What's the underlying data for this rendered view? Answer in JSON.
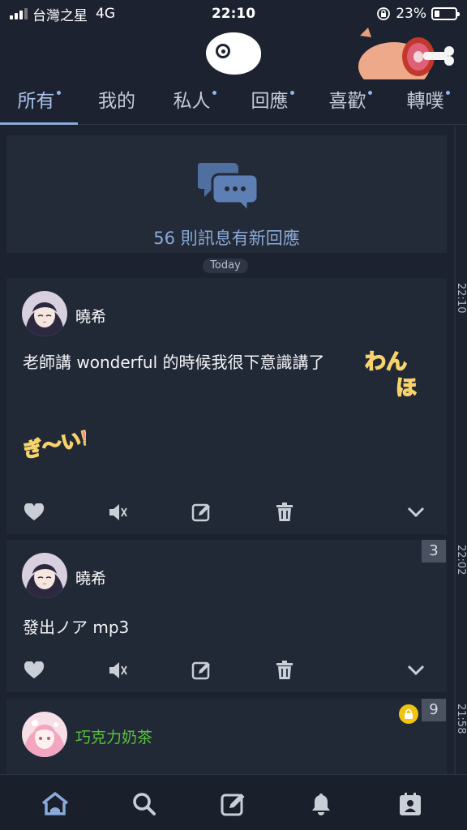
{
  "status_bar": {
    "carrier": "台灣之星",
    "network": "4G",
    "time": "22:10",
    "battery_percent_text": "23%",
    "battery_level": 0.23
  },
  "tabs": [
    {
      "label": "所有",
      "active": true,
      "dot": true
    },
    {
      "label": "我的",
      "active": false,
      "dot": false
    },
    {
      "label": "私人",
      "active": false,
      "dot": true
    },
    {
      "label": "回應",
      "active": false,
      "dot": true
    },
    {
      "label": "喜歡",
      "active": false,
      "dot": true
    },
    {
      "label": "轉噗",
      "active": false,
      "dot": true
    }
  ],
  "new_responses": {
    "text": "56 則訊息有新回應",
    "icon": "chat-bubbles-icon"
  },
  "today_label": "Today",
  "posts": [
    {
      "author": "曉希",
      "content": "老師講 wonderful 的時候我很下意識講了",
      "sticker_text_1": "わん",
      "sticker_text_2": "ほ",
      "sticker_text_3": "ぎ〜い!",
      "timestamp": "22:10",
      "name_color": "#ffffff"
    },
    {
      "author": "曉希",
      "content": "發出ノア mp3",
      "timestamp": "22:02",
      "response_count": "3",
      "name_color": "#ffffff"
    },
    {
      "author": "巧克力奶茶",
      "timestamp": "21:58",
      "response_count": "9",
      "name_color": "#58c33e",
      "locked": true
    }
  ],
  "actions": [
    "heart-icon",
    "mute-icon",
    "edit-icon",
    "trash-icon",
    "chevron-down-icon"
  ],
  "bottom_nav": [
    "home-icon",
    "search-icon",
    "compose-icon",
    "bell-icon",
    "profile-card-icon"
  ],
  "colors": {
    "background": "#1c2230",
    "card": "#212836",
    "accent": "#8aaad8",
    "green_name": "#58c33e"
  }
}
